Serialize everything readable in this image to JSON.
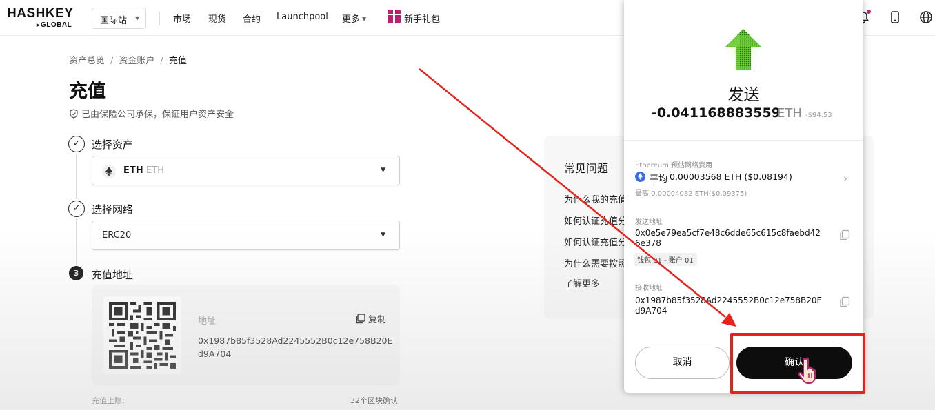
{
  "nav": {
    "logo_main": "HASHKEY",
    "logo_sub": "GLOBAL",
    "site": "国际站",
    "items": [
      "市场",
      "现货",
      "合约",
      "Launchpool",
      "更多"
    ],
    "gift_label": "新手礼包"
  },
  "page": {
    "breadcrumb": [
      "资产总览",
      "资金账户",
      "充值"
    ],
    "title": "充值",
    "insurance_note": "已由保险公司承保，保证用户资产安全",
    "steps": {
      "asset_label": "选择资产",
      "asset_code": "ETH",
      "asset_sub": "ETH",
      "network_label": "选择网络",
      "network_value": "ERC20",
      "address_step_number": "3",
      "address_label": "充值地址"
    },
    "address_card": {
      "label": "地址",
      "copy_label": "复制",
      "address": "0x1987b85f3528Ad2245552B0c12e758B20Ed9A704"
    },
    "bottom": {
      "label": "充值上账:",
      "value": "32个区块确认"
    }
  },
  "faq": {
    "title": "常见问题",
    "items": [
      "为什么我的充值",
      "如何认证充值分",
      "如何认证充值分",
      "为什么需要按照"
    ],
    "more": "了解更多"
  },
  "wallet": {
    "title": "发送",
    "amount": "-0.041168883559",
    "unit": "ETH",
    "usd": "-$94.53",
    "fee_label": "Ethereum 预估网络费用",
    "fee_tier": "平均",
    "fee_value": "0.00003568 ETH ($0.08194)",
    "fee_max": "最高 0.00004082 ETH($0.09375)",
    "from_label": "发送地址",
    "from_address": "0x0e5e79ea5cf7e48c6dde65c615c8faebd426e378",
    "wallet_tag": "钱包 01 - 账户 01",
    "to_label": "接收地址",
    "to_address": "0x1987b85f3528Ad2245552B0c12e758B20Ed9A704",
    "cancel_label": "取消",
    "confirm_label": "确认"
  },
  "colors": {
    "accent_brand": "#b3246f",
    "annotation_red": "#e8211b",
    "send_arrow_green": "#52c41a",
    "confirm_bg": "#0d0d0d"
  }
}
